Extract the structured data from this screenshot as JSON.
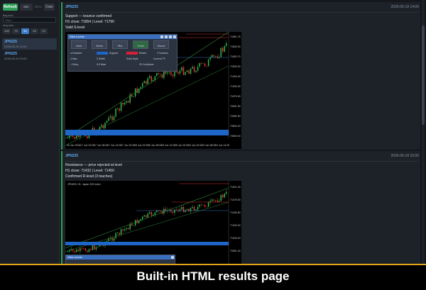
{
  "sidebar": {
    "toolbar": {
      "refresh": "Refresh",
      "asc": "asc",
      "desc": "desc",
      "date": "Date"
    },
    "filter": {
      "label": "ting slot:",
      "placeholder": "Filter..."
    },
    "size": {
      "label": "Img size:",
      "options": [
        "100",
        "75",
        "50",
        "25",
        "10"
      ],
      "selected": "50"
    },
    "items": [
      {
        "symbol": "JPN225",
        "date": "2026-06-19 14:00"
      },
      {
        "symbol": "JPN225",
        "date": "2026-06-19 10:00"
      }
    ]
  },
  "results": [
    {
      "symbol": "JPN225",
      "date": "2026-06-19 14:00",
      "headline": "Support — bounce confirmed",
      "detail": "H1 close: 71854 | Level: 71790",
      "note": "Valid S-level",
      "chart": {
        "price_labels": [
          "71851.78",
          "71800.00",
          "71600.70",
          "71500.00",
          "71400.40",
          "71300.40",
          "71075.30",
          "70951.60",
          "70950.90",
          "70800.20",
          "70800.00"
        ],
        "time_labels": [
          "16 Jun 2026",
          "17 Jun 02:00",
          "17 Jun 08:00",
          "17 Jun 14:00",
          "17 Jun 20:00",
          "18 Jun 02:00",
          "18 Jun 08:00",
          "18 Jun 14:00",
          "18 Jun 20:00",
          "19 Jun 02:00",
          "19 Jun 08:00",
          "19 Jun 14:00"
        ]
      },
      "panel": {
        "title": "Vibe Levels",
        "tools": [
          "Lines",
          "Zones",
          "Fibo",
          "Trend",
          "Round"
        ],
        "rows": {
          "enabled": "Enabled",
          "support": "Support",
          "resist": "Resist",
          "touches": "Touches",
          "touches_val": "3",
          "max_label": "Max",
          "max_val": "4",
          "width_label": "Width",
          "width_val": "3",
          "style": "Solid",
          "style_label": "Style",
          "current": "Current",
          "tf": "TF",
          "entry": "Entry",
          "near_label": "Near",
          "near_val": "0.5",
          "cooldown_label": "Cooldown",
          "cooldown_val": "20"
        }
      }
    },
    {
      "symbol": "JPN225",
      "date": "2026-06-19 10:00",
      "headline": "Resistance — price rejected at level",
      "detail": "H1 close: 71432 | Level: 71450",
      "note": "Confirmed R-level (3 touches)",
      "chart": {
        "header": "JPN225, H1:  Japan 225 Index",
        "price_labels": [
          "71521.93",
          "71475.00",
          "71400.60",
          "71300.00",
          "71029.20",
          "70961.40"
        ]
      },
      "panel": {
        "title": "Vibe Levels"
      }
    }
  ],
  "banner": {
    "text": "Built-in HTML results page"
  },
  "colors": {
    "accent": "#2f9e58",
    "link": "#5ea9ef",
    "bull": "#2fb84f",
    "bear": "#e0392f",
    "banner_rule": "#e0a51a"
  }
}
